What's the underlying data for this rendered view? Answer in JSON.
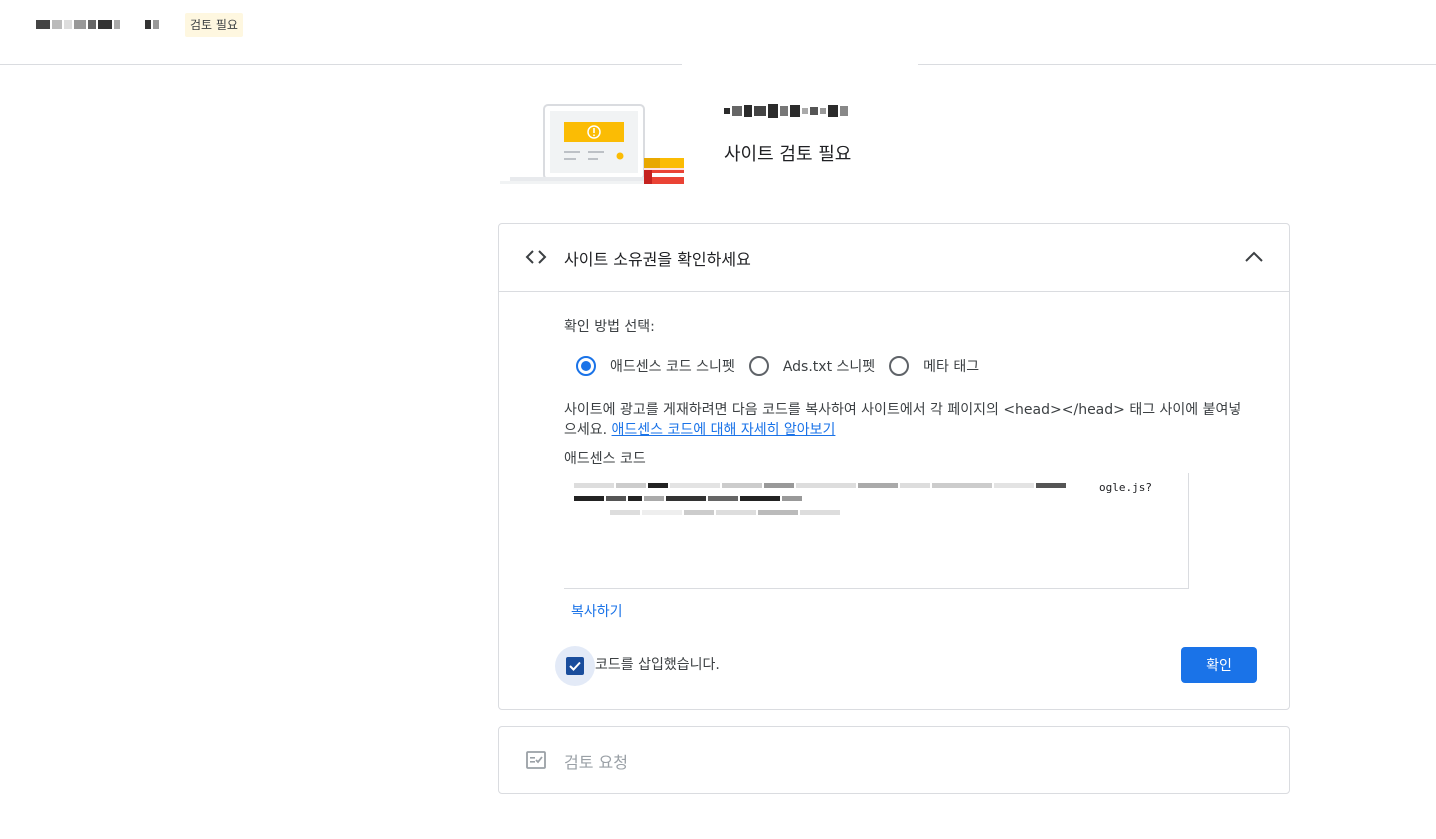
{
  "topbar": {
    "status_chip": "검토 필요"
  },
  "hero": {
    "subtitle": "사이트 검토 필요"
  },
  "ownership_card": {
    "title": "사이트 소유권을 확인하세요",
    "method_label": "확인 방법 선택:",
    "methods": [
      {
        "label": "애드센스 코드 스니펫",
        "selected": true
      },
      {
        "label": "Ads.txt 스니펫",
        "selected": false
      },
      {
        "label": "메타 태그",
        "selected": false
      }
    ],
    "description": "사이트에 광고를 게재하려면 다음 코드를 복사하여 사이트에서 각 페이지의 <head></head> 태그 사이에 붙여넣으세요.",
    "learn_more_link": "애드센스 코드에 대해 자세히 알아보기",
    "code_label": "애드센스 코드",
    "code_visible_fragment": "ogle.js?",
    "copy_label": "복사하기",
    "checkbox_label": "코드를 삽입했습니다.",
    "checkbox_checked": true,
    "confirm_label": "확인"
  },
  "review_card": {
    "title": "검토 요청"
  },
  "colors": {
    "accent": "#1a73e8",
    "chip_bg": "#fef7e0",
    "border": "#dadce0",
    "warning": "#fbbc04"
  }
}
